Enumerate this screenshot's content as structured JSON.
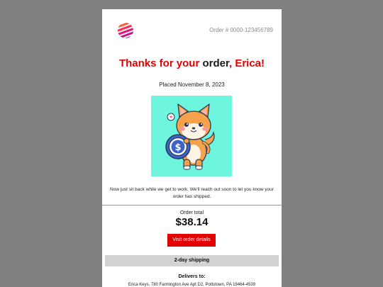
{
  "header": {
    "order_number": "Order # 0000-123456789",
    "logo": "striped-globe-logo"
  },
  "title": {
    "part1": "Thanks for your ",
    "part2": "order",
    "part3": ", Erica!"
  },
  "placed_date": "Placed November 8, 2023",
  "hero_image": "shiba-dog-holding-dollar-coin",
  "message": "Now just sit back while we get to work. We'll reach out soon to let you know your order has shipped.",
  "order": {
    "total_label": "Order total",
    "total_amount": "$38.14",
    "details_button": "Visit order details"
  },
  "shipping": {
    "method": "2-day shipping",
    "deliver_label": "Delivers to:",
    "address": "Erica Keys, 780 Farmington Ave Apt D2, Pottstown, PA 19464-4539"
  },
  "colors": {
    "accent": "#e30000",
    "page_bg": "#808080",
    "hero_bg": "#6ef5dd"
  }
}
